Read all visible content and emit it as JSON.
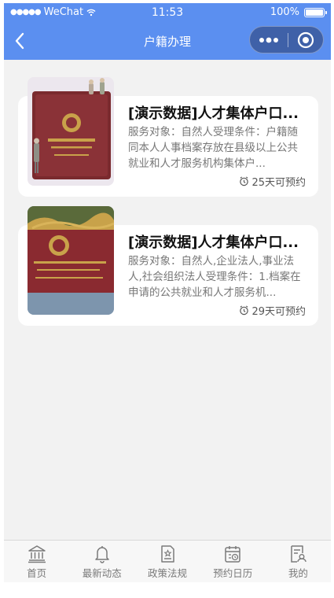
{
  "status_bar": {
    "carrier": "WeChat",
    "time": "11:53",
    "battery": "100%"
  },
  "nav": {
    "title": "户籍办理"
  },
  "cards": [
    {
      "title": "[演示数据]人才集体户口...",
      "description": "服务对象：自然人受理条件：户籍随同本人人事档案存放在县级以上公共就业和人才服务机构集体户...",
      "meta": "25天可预约"
    },
    {
      "title": "[演示数据]人才集体户口...",
      "description": "服务对象：自然人,企业法人,事业法人,社会组织法人受理条件：1.档案在申请的公共就业和人才服务机...",
      "meta": "29天可预约"
    }
  ],
  "tabs": [
    {
      "label": "首页",
      "icon": "bank-icon"
    },
    {
      "label": "最新动态",
      "icon": "bell-icon"
    },
    {
      "label": "政策法规",
      "icon": "document-star-icon"
    },
    {
      "label": "预约日历",
      "icon": "calendar-icon"
    },
    {
      "label": "我的",
      "icon": "profile-doc-icon"
    }
  ],
  "colors": {
    "nav_background": "#5b8ff0",
    "page_background": "#f2f2f2",
    "tab_label": "#7a7a7a"
  }
}
